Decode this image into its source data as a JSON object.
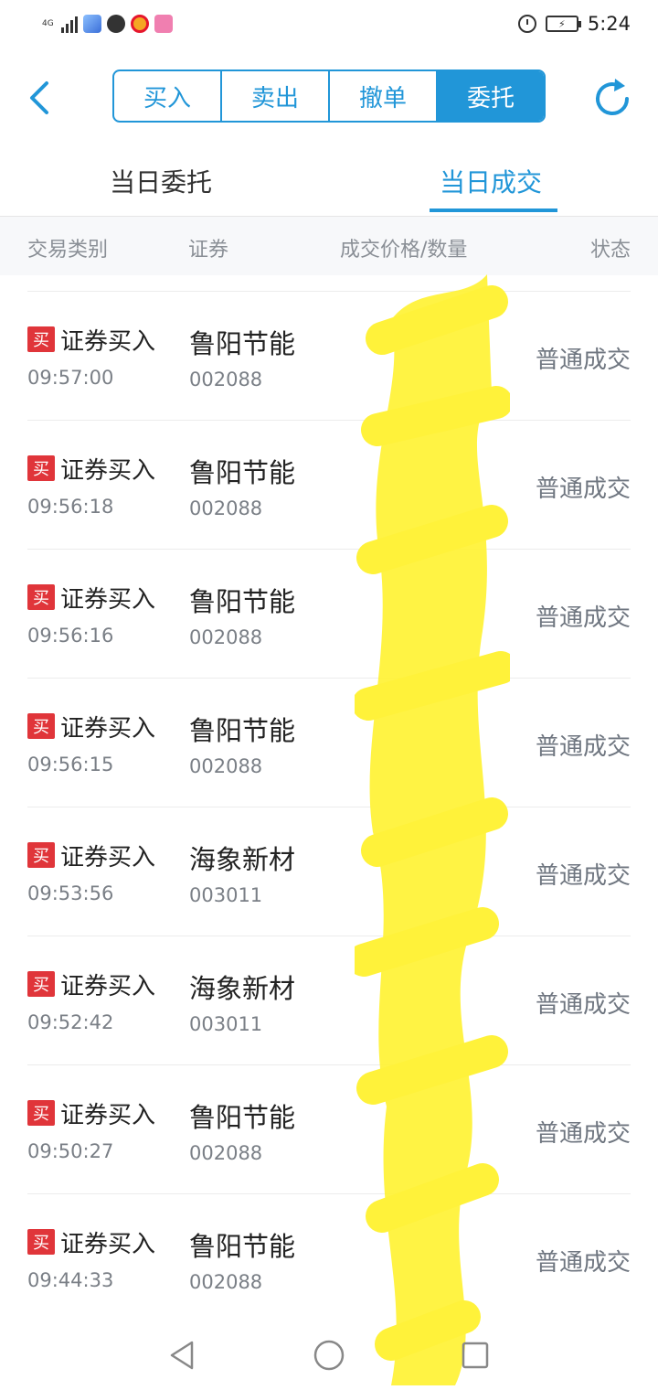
{
  "status_bar": {
    "network": "4G",
    "time": "5:24"
  },
  "nav": {
    "back_icon": "back-chevron-icon",
    "segments": [
      {
        "label": "买入",
        "active": false
      },
      {
        "label": "卖出",
        "active": false
      },
      {
        "label": "撤单",
        "active": false
      },
      {
        "label": "委托",
        "active": true
      }
    ],
    "refresh_icon": "refresh-icon"
  },
  "tabs": [
    {
      "label": "当日委托",
      "active": false
    },
    {
      "label": "当日成交",
      "active": true
    }
  ],
  "columns": [
    "交易类别",
    "证券",
    "成交价格/数量",
    "状态"
  ],
  "trades": [
    {
      "badge": "买",
      "type": "证券买入",
      "time": "09:57:00",
      "name": "鲁阳节能",
      "code": "002088",
      "status": "普通成交"
    },
    {
      "badge": "买",
      "type": "证券买入",
      "time": "09:56:18",
      "name": "鲁阳节能",
      "code": "002088",
      "status": "普通成交"
    },
    {
      "badge": "买",
      "type": "证券买入",
      "time": "09:56:16",
      "name": "鲁阳节能",
      "code": "002088",
      "status": "普通成交"
    },
    {
      "badge": "买",
      "type": "证券买入",
      "time": "09:56:15",
      "name": "鲁阳节能",
      "code": "002088",
      "status": "普通成交"
    },
    {
      "badge": "买",
      "type": "证券买入",
      "time": "09:53:56",
      "name": "海象新材",
      "code": "003011",
      "status": "普通成交"
    },
    {
      "badge": "买",
      "type": "证券买入",
      "time": "09:52:42",
      "name": "海象新材",
      "code": "003011",
      "status": "普通成交"
    },
    {
      "badge": "买",
      "type": "证券买入",
      "time": "09:50:27",
      "name": "鲁阳节能",
      "code": "002088",
      "status": "普通成交"
    },
    {
      "badge": "买",
      "type": "证券买入",
      "time": "09:44:33",
      "name": "鲁阳节能",
      "code": "002088",
      "status": "普通成交"
    }
  ],
  "colors": {
    "accent": "#2196d8",
    "buy_badge": "#e0353a",
    "censor": "#fff23a"
  }
}
